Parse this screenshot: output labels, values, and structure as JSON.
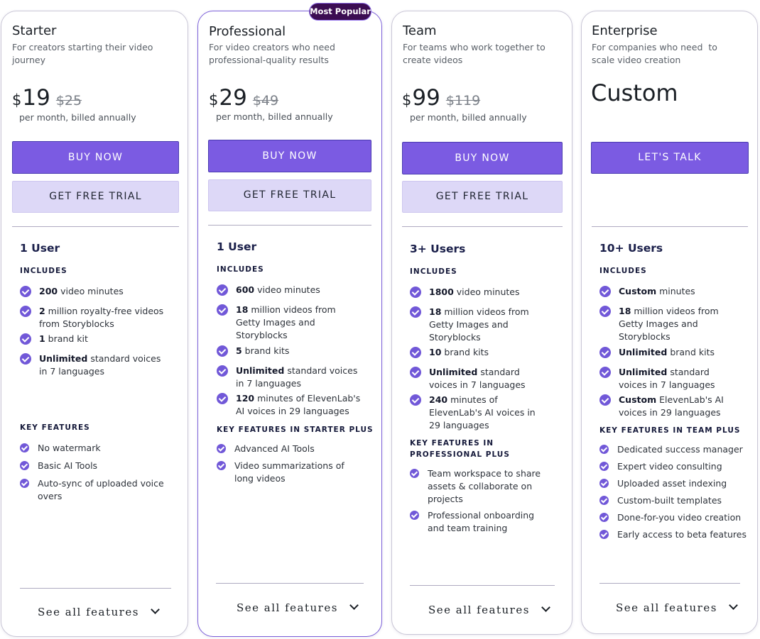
{
  "popular_badge": "Most Popular",
  "plans": [
    {
      "name": "Starter",
      "desc_lines": [
        "For creators starting their video",
        "journey"
      ],
      "currency": "$",
      "price": "19",
      "old_price": "$25",
      "billed": "per month, billed annually",
      "buy_label": "BUY NOW",
      "trial_label": "GET FREE TRIAL",
      "users": "1 User",
      "includes_label": "INCLUDES",
      "includes": [
        {
          "bold": "200",
          "text": " video minutes"
        },
        {
          "bold": "2",
          "text": " million royalty-free videos from Storyblocks"
        },
        {
          "bold": "1",
          "text": " brand kit"
        },
        {
          "bold": "Unlimited",
          "text": " standard voices in 7 languages"
        }
      ],
      "features_label": "KEY FEATURES",
      "features": [
        "No watermark",
        "Basic AI Tools",
        "Auto-sync of uploaded voice overs"
      ],
      "see_all": "See all features"
    },
    {
      "name": "Professional",
      "desc_lines": [
        "For video creators who need",
        "professional-quality results"
      ],
      "currency": "$",
      "price": "29",
      "old_price": "$49",
      "billed": "per month, billed annually",
      "buy_label": "BUY NOW",
      "trial_label": "GET FREE TRIAL",
      "users": "1 User",
      "includes_label": "INCLUDES",
      "includes": [
        {
          "bold": "600",
          "text": " video minutes"
        },
        {
          "bold": "18",
          "text": " million videos from Getty Images and Storyblocks"
        },
        {
          "bold": "5",
          "text": " brand kits"
        },
        {
          "bold": "Unlimited",
          "text": " standard voices in 7 languages"
        },
        {
          "bold": "120",
          "text": " minutes of ElevenLab's AI voices in 29 languages"
        }
      ],
      "features_label": "KEY FEATURES IN STARTER PLUS",
      "features": [
        "Advanced AI Tools",
        "Video summarizations of long videos"
      ],
      "see_all": "See all features"
    },
    {
      "name": "Team",
      "desc_lines": [
        "For teams who work together to",
        "create videos"
      ],
      "currency": "$",
      "price": "99",
      "old_price": "$119",
      "billed": "per month, billed annually",
      "buy_label": "BUY NOW",
      "trial_label": "GET FREE TRIAL",
      "users": "3+ Users",
      "includes_label": "INCLUDES",
      "includes": [
        {
          "bold": "1800",
          "text": " video minutes"
        },
        {
          "bold": "18",
          "text": " million videos from Getty Images and Storyblocks"
        },
        {
          "bold": "10",
          "text": " brand kits"
        },
        {
          "bold": "Unlimited",
          "text": " standard voices in 7 languages"
        },
        {
          "bold": "240",
          "text": " minutes of ElevenLab's AI voices in 29 languages"
        }
      ],
      "features_label_lines": [
        "KEY FEATURES IN",
        "PROFESSIONAL PLUS"
      ],
      "features": [
        "Team workspace to share assets & collaborate on projects",
        "Professional onboarding and team training"
      ],
      "see_all": "See all features"
    },
    {
      "name": "Enterprise",
      "desc_lines": [
        "For companies who need  to",
        "scale video creation"
      ],
      "price_text": "Custom",
      "talk_label": "LET'S TALK",
      "users": "10+ Users",
      "includes_label": "INCLUDES",
      "includes": [
        {
          "bold": "Custom",
          "text": " minutes"
        },
        {
          "bold": "18",
          "text": " million videos from Getty Images and Storyblocks"
        },
        {
          "bold": "Unlimited",
          "text": " brand kits"
        },
        {
          "bold": "Unlimited",
          "text": " standard voices in 7 languages"
        },
        {
          "bold": "Custom",
          "text": " ElevenLab's AI voices in 29 languages"
        }
      ],
      "features_label": "KEY FEATURES IN TEAM PLUS",
      "features": [
        "Dedicated success manager",
        "Expert video consulting",
        "Uploaded asset indexing",
        "Custom-built templates",
        "Done-for-you video creation",
        "Early access to beta features"
      ],
      "see_all": "See all features"
    }
  ],
  "colors": {
    "accent": "#7b5be2",
    "trial": "#ddd8f7",
    "badge": "#3b0d52",
    "check": "#7158d8"
  }
}
